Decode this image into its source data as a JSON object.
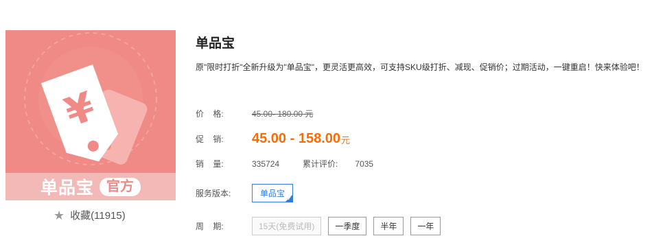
{
  "product": {
    "image": {
      "banner_title": "单品宝",
      "banner_badge": "官方",
      "icon": "price-tag-yen-icon"
    },
    "favorite": {
      "icon": "star-icon",
      "label": "收藏(11915)"
    },
    "title": "单品宝",
    "description": "原\"限时打折\"全新升级为\"单品宝\"，更灵活更高效，可支持SKU级打折、减现、促销价；过期活动，一键重启！快来体验吧！"
  },
  "price": {
    "label": "价    格:",
    "value": "45.00- 180.00 元"
  },
  "promo": {
    "label": "促    销:",
    "value": "45.00 - 158.00",
    "unit": "元",
    "color": "#ff6a00"
  },
  "sales": {
    "label": "销    量:",
    "value": "335724",
    "eval_label": "累计评价:",
    "eval_value": "7035"
  },
  "version": {
    "label": "服务版本:",
    "selected": "单品宝",
    "accent": "#2f7de1"
  },
  "period": {
    "label": "周    期:",
    "options": [
      "15天(免费试用)",
      "一季度",
      "半年",
      "一年"
    ]
  }
}
